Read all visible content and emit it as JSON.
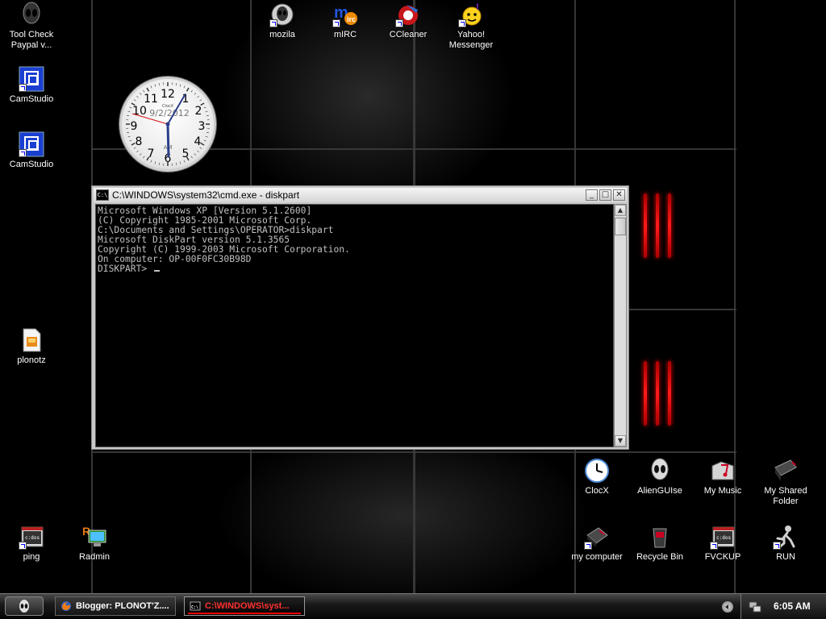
{
  "desktop": {
    "icons": [
      {
        "label": "Tool Check\nPaypal v..."
      },
      {
        "label": "CamStudio"
      },
      {
        "label": "CamStudio"
      },
      {
        "label": "plonotz"
      },
      {
        "label": "ping"
      },
      {
        "label": "Radmin"
      },
      {
        "label": "mozila"
      },
      {
        "label": "mIRC"
      },
      {
        "label": "CCleaner"
      },
      {
        "label": "Yahoo!\nMessenger"
      },
      {
        "label": "ClocX"
      },
      {
        "label": "AlienGUIse"
      },
      {
        "label": "My Music"
      },
      {
        "label": "My Shared\nFolder"
      },
      {
        "label": "my computer"
      },
      {
        "label": "Recycle Bin"
      },
      {
        "label": "FVCKUP"
      },
      {
        "label": "RUN"
      }
    ]
  },
  "clock_widget": {
    "date": "9/2/2012",
    "ampm": "AM",
    "numerals": [
      "12",
      "1",
      "2",
      "3",
      "4",
      "5",
      "6",
      "7",
      "8",
      "9",
      "10",
      "11"
    ],
    "brand": "ClocX"
  },
  "cmd_window": {
    "title": "C:\\WINDOWS\\system32\\cmd.exe - diskpart",
    "icon_text": "C:\\",
    "minimize_label": "_",
    "maximize_label": "□",
    "close_label": "✕",
    "lines": [
      "Microsoft Windows XP [Version 5.1.2600]",
      "(C) Copyright 1985-2001 Microsoft Corp.",
      "",
      "C:\\Documents and Settings\\OPERATOR>diskpart",
      "",
      "Microsoft DiskPart version 5.1.3565",
      "",
      "Copyright (C) 1999-2003 Microsoft Corporation.",
      "On computer: OP-00F0FC30B98D",
      ""
    ],
    "prompt": "DISKPART> "
  },
  "taskbar": {
    "tasks": [
      {
        "label": "Blogger: PLONOT'Z...."
      },
      {
        "label": "C:\\WINDOWS\\syst..."
      }
    ],
    "time": "6:05 AM"
  },
  "colors": {
    "accent_red": "#ff3030",
    "console_text": "#c0c0c0"
  }
}
